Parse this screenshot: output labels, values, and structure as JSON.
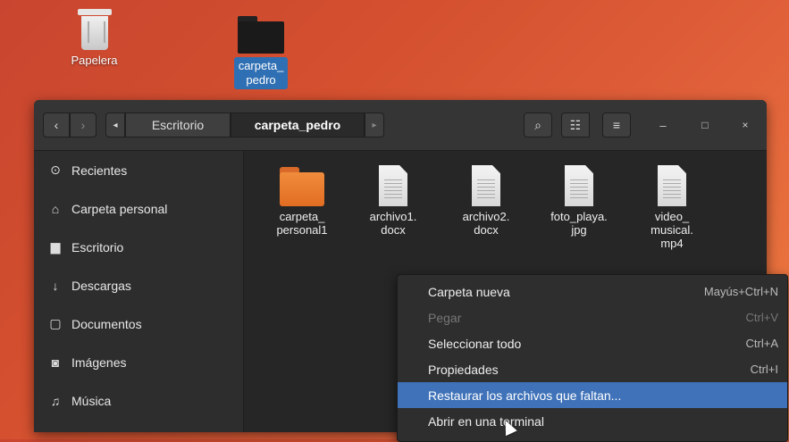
{
  "desktop": {
    "trash_label": "Papelera",
    "folder_label_line1": "carpeta_",
    "folder_label_line2": "pedro"
  },
  "headerbar": {
    "back": "‹",
    "forward": "›",
    "path_prev": "◂",
    "path_items": [
      "Escritorio",
      "carpeta_pedro"
    ],
    "path_next": "▸",
    "search_glyph": "⌕",
    "list_glyph": "☷",
    "menu_glyph": "≡",
    "minimize": "–",
    "maximize": "□",
    "close": "×"
  },
  "sidebar": {
    "items": [
      {
        "label": "Recientes",
        "icon": "clock-icon",
        "glyph": "⊙"
      },
      {
        "label": "Carpeta personal",
        "icon": "home-icon",
        "glyph": "⌂"
      },
      {
        "label": "Escritorio",
        "icon": "folder-icon",
        "glyph": "▆"
      },
      {
        "label": "Descargas",
        "icon": "download-icon",
        "glyph": "↓"
      },
      {
        "label": "Documentos",
        "icon": "document-icon",
        "glyph": "▢"
      },
      {
        "label": "Imágenes",
        "icon": "camera-icon",
        "glyph": "◙"
      },
      {
        "label": "Música",
        "icon": "music-icon",
        "glyph": "♫"
      }
    ]
  },
  "files": [
    {
      "line1": "carpeta_",
      "line2": "personal1",
      "line3": "",
      "type": "folder"
    },
    {
      "line1": "archivo1.",
      "line2": "docx",
      "line3": "",
      "type": "doc"
    },
    {
      "line1": "archivo2.",
      "line2": "docx",
      "line3": "",
      "type": "doc"
    },
    {
      "line1": "foto_playa.",
      "line2": "jpg",
      "line3": "",
      "type": "doc"
    },
    {
      "line1": "video_",
      "line2": "musical.",
      "line3": "mp4",
      "type": "doc"
    }
  ],
  "context_menu": [
    {
      "label": "Carpeta nueva",
      "shortcut": "Mayús+Ctrl+N"
    },
    {
      "label": "Pegar",
      "shortcut": "Ctrl+V"
    },
    {
      "label": "Seleccionar todo",
      "shortcut": "Ctrl+A"
    },
    {
      "label": "Propiedades",
      "shortcut": "Ctrl+I"
    },
    {
      "label": "Restaurar los archivos que faltan...",
      "shortcut": ""
    },
    {
      "label": "Abrir en una terminal",
      "shortcut": ""
    }
  ],
  "colors": {
    "highlight": "#3f72b8",
    "folder_orange": "#e26d23"
  }
}
